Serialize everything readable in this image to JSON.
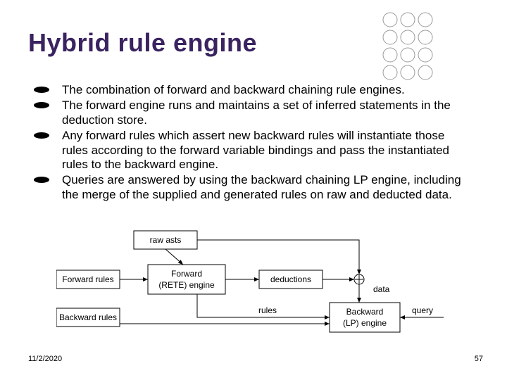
{
  "title": "Hybrid rule engine",
  "bullets": [
    "The combination of forward and backward chaining rule engines.",
    "The forward engine runs and maintains a set of inferred statements in the deduction store.",
    "Any forward rules which assert new backward rules will instantiate those rules according to the forward variable bindings and pass the instantiated rules to the backward engine.",
    "Queries are answered by using the backward chaining LP engine, including the merge of the supplied and generated rules on raw and deducted data."
  ],
  "diagram": {
    "raw_asts": "raw asts",
    "forward_rules": "Forward rules",
    "backward_rules": "Backward rules",
    "forward_engine_l1": "Forward",
    "forward_engine_l2": "(RETE) engine",
    "deductions": "deductions",
    "backward_engine_l1": "Backward",
    "backward_engine_l2": "(LP) engine",
    "rules_arrow": "rules",
    "data_label": "data",
    "query_label": "query"
  },
  "footer": {
    "date": "11/2/2020",
    "page": "57"
  }
}
